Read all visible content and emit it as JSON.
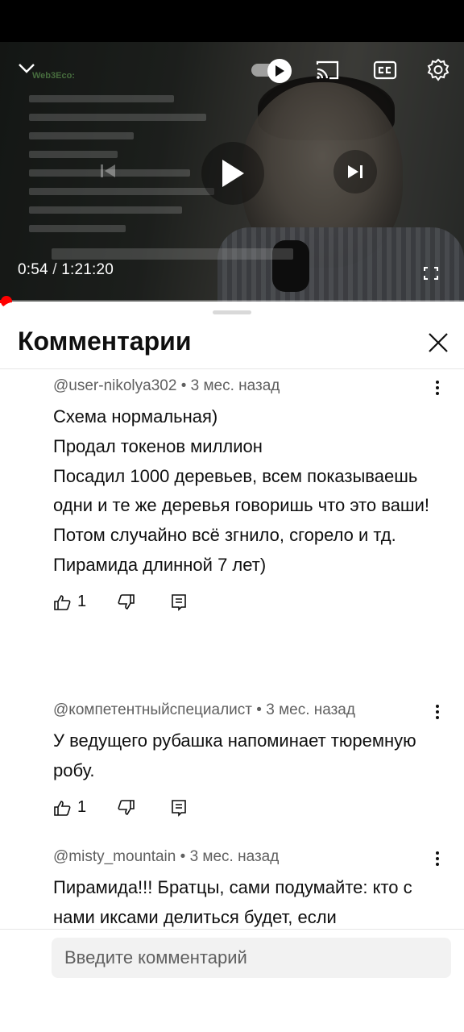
{
  "player": {
    "current_time": "0:54",
    "separator": "/",
    "duration": "1:21:20",
    "progress_fraction": 0.011,
    "overlay_brand": "Web3Eco:",
    "autoplay_on": true,
    "icons": {
      "minimize": "chevron-down-icon",
      "autoplay": "autoplay-toggle-icon",
      "cast": "cast-icon",
      "captions": "cc-icon",
      "settings": "gear-icon",
      "previous": "skip-previous-icon",
      "play": "play-icon",
      "next": "skip-next-icon",
      "fullscreen": "fullscreen-icon"
    }
  },
  "comments_panel": {
    "title": "Комментарии",
    "close_icon": "close-icon",
    "items": [
      {
        "author": "@user-nikolya302",
        "time": "3 мес. назад",
        "text": "Схема нормальная)\nПродал токенов миллион\nПосадил 1000 деревьев, всем показываешь одни и те же деревья говоришь что это ваши!\nПотом случайно всё згнило, сгорело и тд.\nПирамида длинной 7 лет)",
        "likes": "1"
      },
      {
        "author": "@компетентныйспециалист",
        "time": "3 мес. назад",
        "text": "У ведущего рубашка напоминает тюремную робу.",
        "likes": "1"
      },
      {
        "author": "@misty_mountain",
        "time": "3 мес. назад",
        "text": "Пирамида!!! Братцы, сами подумайте: кто с нами иксами делиться будет, если",
        "likes": ""
      }
    ]
  },
  "input": {
    "placeholder": "Введите комментарий"
  },
  "colors": {
    "accent_red": "#ff0000",
    "text_primary": "#0f0f0f",
    "text_secondary": "#606060",
    "input_bg": "#f2f2f2"
  }
}
